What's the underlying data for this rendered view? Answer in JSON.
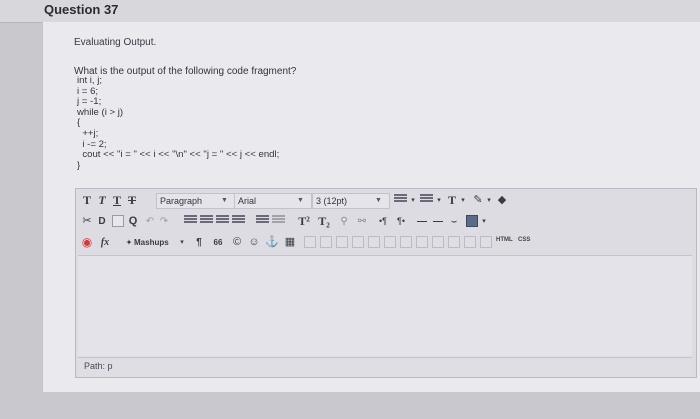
{
  "question": {
    "title": "Question 37"
  },
  "content": {
    "section_label": "Evaluating Output.",
    "prompt": "What is the output of the following code fragment?",
    "code_lines": [
      "int i, j;",
      "i = 6;",
      "j = -1;",
      "while (i > j)",
      "{",
      "  ++j;",
      "  i -= 2;",
      "  cout << \"i = \" << i << \"\\n\" << \"j = \" << j << endl;",
      "}"
    ]
  },
  "editor": {
    "toolbar": {
      "format_buttons": [
        "T",
        "T",
        "T",
        "T"
      ],
      "paragraph_select": "Paragraph",
      "font_select": "Arial",
      "size_select": "3 (12pt)",
      "text_color_label": "T",
      "mashups_label": "Mashups",
      "fx_label": "fx",
      "superscript_label": "T²",
      "subscript_label": "T₂",
      "quote_glyph": "66",
      "paragraph_glyph": "¶",
      "html_label": "HTML",
      "css_label": "CSS"
    },
    "path_label": "Path: p"
  },
  "colors": {
    "background": "#c9c9cd",
    "card": "#e9e9ee",
    "editor": "#dcdce2",
    "danger": "#d23a3a",
    "accent_blue": "#3a6fb0"
  }
}
